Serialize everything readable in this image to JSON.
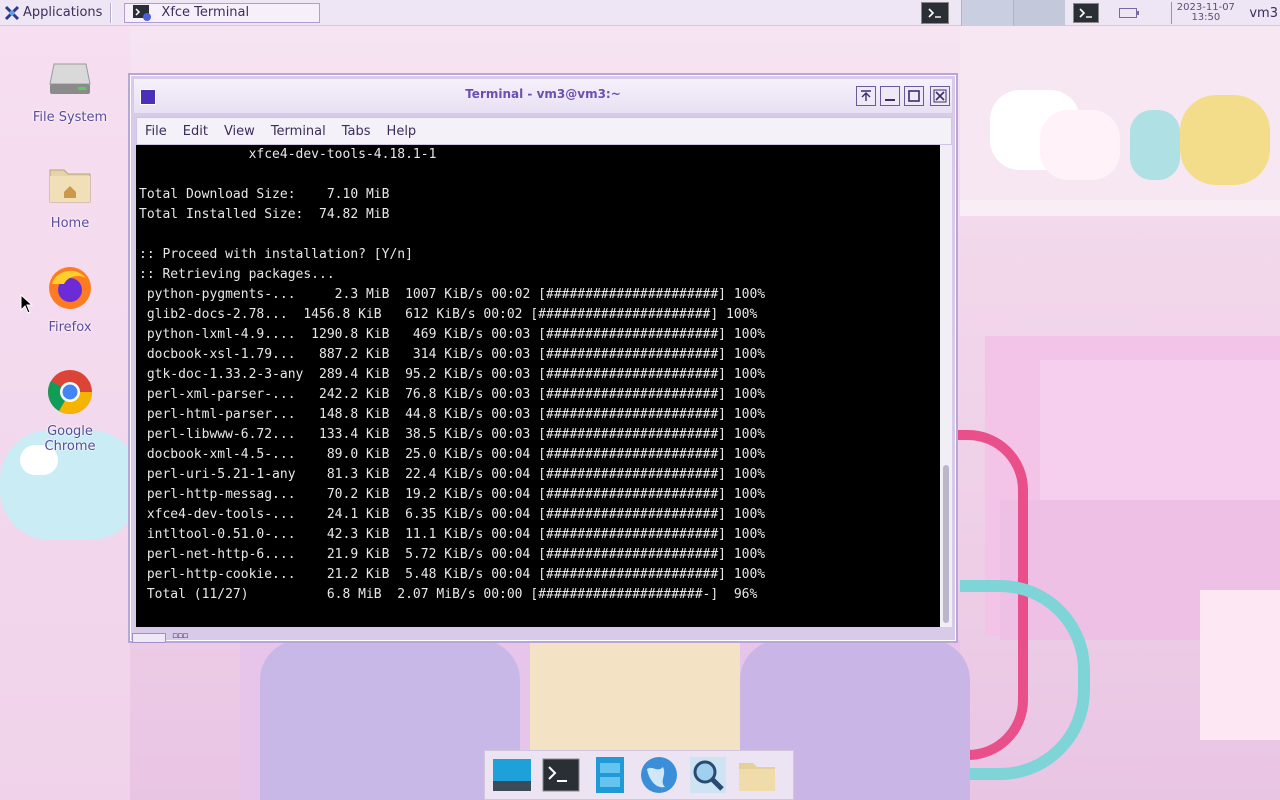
{
  "top_panel": {
    "applications_label": "Applications",
    "task_title": "Xfce Terminal",
    "clock_text": "2023-11-07\n13:50",
    "user_label": "vm3"
  },
  "desktop": {
    "icons": [
      {
        "label": "File System"
      },
      {
        "label": "Home"
      },
      {
        "label": "Firefox"
      },
      {
        "label": "Google Chrome"
      }
    ]
  },
  "window": {
    "title": "Terminal - vm3@vm3:~",
    "menu": [
      "File",
      "Edit",
      "View",
      "Terminal",
      "Tabs",
      "Help"
    ]
  },
  "terminal": {
    "lines": [
      "              xfce4-dev-tools-4.18.1-1",
      "",
      "Total Download Size:    7.10 MiB",
      "Total Installed Size:  74.82 MiB",
      "",
      ":: Proceed with installation? [Y/n]",
      ":: Retrieving packages...",
      " python-pygments-...     2.3 MiB  1007 KiB/s 00:02 [######################] 100%",
      " glib2-docs-2.78...  1456.8 KiB   612 KiB/s 00:02 [######################] 100%",
      " python-lxml-4.9....  1290.8 KiB   469 KiB/s 00:03 [######################] 100%",
      " docbook-xsl-1.79...   887.2 KiB   314 KiB/s 00:03 [######################] 100%",
      " gtk-doc-1.33.2-3-any  289.4 KiB  95.2 KiB/s 00:03 [######################] 100%",
      " perl-xml-parser-...   242.2 KiB  76.8 KiB/s 00:03 [######################] 100%",
      " perl-html-parser...   148.8 KiB  44.8 KiB/s 00:03 [######################] 100%",
      " perl-libwww-6.72...   133.4 KiB  38.5 KiB/s 00:03 [######################] 100%",
      " docbook-xml-4.5-...    89.0 KiB  25.0 KiB/s 00:04 [######################] 100%",
      " perl-uri-5.21-1-any    81.3 KiB  22.4 KiB/s 00:04 [######################] 100%",
      " perl-http-messag...    70.2 KiB  19.2 KiB/s 00:04 [######################] 100%",
      " xfce4-dev-tools-...    24.1 KiB  6.35 KiB/s 00:04 [######################] 100%",
      " intltool-0.51.0-...    42.3 KiB  11.1 KiB/s 00:04 [######################] 100%",
      " perl-net-http-6....    21.9 KiB  5.72 KiB/s 00:04 [######################] 100%",
      " perl-http-cookie...    21.2 KiB  5.48 KiB/s 00:04 [######################] 100%",
      " Total (11/27)          6.8 MiB  2.07 MiB/s 00:00 [#####################-]  96%"
    ]
  },
  "colors": {
    "terminal_bg": "#000000",
    "terminal_fg": "#e8e8e8",
    "title_text": "#6c4fb0",
    "window_frame": "#d7cbe9"
  },
  "icons": [
    "xfce-logo-icon",
    "terminal-icon",
    "battery-icon",
    "drive-icon",
    "home-folder-icon",
    "firefox-icon",
    "chrome-icon",
    "cursor-icon"
  ]
}
